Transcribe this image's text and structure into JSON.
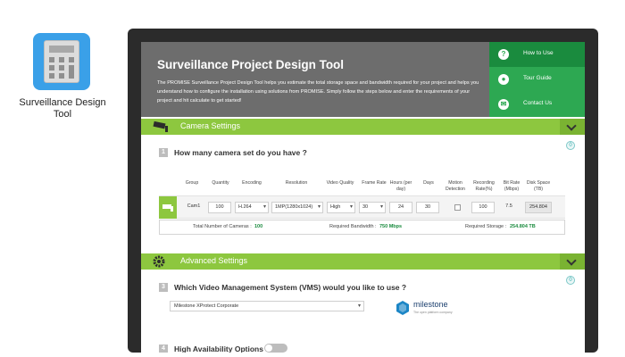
{
  "desktop": {
    "app_label": "Surveillance Design Tool"
  },
  "header": {
    "title": "Surveillance Project Design Tool",
    "intro": "The PROMISE Surveillance Project Design Tool helps you estimate the total storage space and bandwidth required for your project and helps you understand how to configure the installation using solutions from PROMISE. Simply follow the steps below and enter the requirements of your project and hit calculate to get started!"
  },
  "side_nav": [
    {
      "label": "How to Use",
      "icon": "question-icon"
    },
    {
      "label": "Tour Guide",
      "icon": "person-icon"
    },
    {
      "label": "Contact Us",
      "icon": "mail-icon"
    }
  ],
  "camera_settings": {
    "title": "Camera Settings",
    "step": "1",
    "question": "How many camera set do you have ?",
    "badge": "0",
    "columns": [
      "Group",
      "Quantity",
      "Encoding",
      "Resolution",
      "Video Quality",
      "Frame Rate",
      "Hours (per day)",
      "Days",
      "Motion Detection",
      "Recording Rate(%)",
      "Bit Rate (Mbps)",
      "Disk Space (TB)"
    ],
    "row": {
      "group": "Cam1",
      "quantity": "100",
      "encoding": "H.264",
      "resolution": "1MP(1280x1024)",
      "video_quality": "High",
      "frame_rate": "30",
      "hours": "24",
      "days": "30",
      "recording_rate": "100",
      "bit_rate": "7.5",
      "disk_space": "254.804"
    },
    "totals": {
      "cameras_label": "Total Number of Cameras :",
      "cameras_value": "100",
      "bandwidth_label": "Required Bandwidth :",
      "bandwidth_value": "750 Mbps",
      "storage_label": "Required Storage :",
      "storage_value": "254.804 TB"
    }
  },
  "advanced_settings": {
    "title": "Advanced Settings",
    "badge": "0",
    "step3": "3",
    "vms_question": "Which Video Management System (VMS) would you like to use ?",
    "vms_selected": "Milestone XProtect Corporate",
    "vms_logo_name": "milestone",
    "vms_logo_tag": "The open platform company",
    "step4": "4",
    "ha_label": "High Availability Options"
  },
  "colors": {
    "green": "#8dc73f",
    "dark_green": "#2da852",
    "header_gray": "#6d6d6d"
  }
}
